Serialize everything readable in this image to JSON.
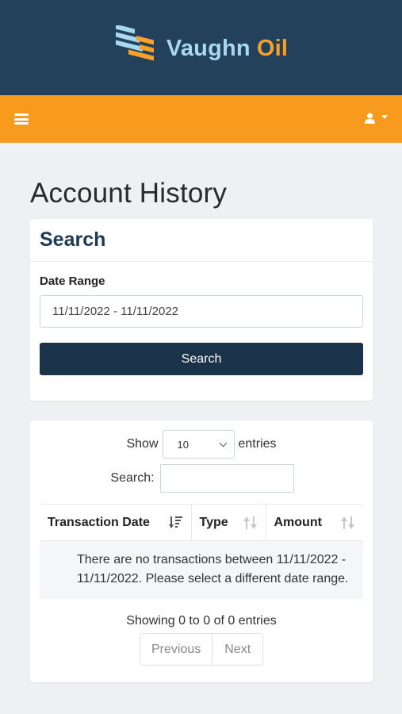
{
  "brand": {
    "name_part1": "Vaughn",
    "name_part2": "Oil"
  },
  "colors": {
    "header": "#23415b",
    "navbar": "#f79a1e",
    "button": "#1b3349",
    "brand_light": "#a8d8f0",
    "brand_accent": "#f7a12a"
  },
  "icons": {
    "menu": "hamburger-icon",
    "user": "user-icon",
    "caret": "caret-down-icon",
    "sort": "sort-icon"
  },
  "page": {
    "title": "Account History"
  },
  "search_card": {
    "heading": "Search",
    "date_range_label": "Date Range",
    "date_range_value": "11/11/2022 - 11/11/2022",
    "search_button": "Search"
  },
  "table_card": {
    "show_label": "Show",
    "entries_per_page": "10",
    "entries_label": "entries",
    "search_label": "Search:",
    "search_value": "",
    "columns": [
      "Transaction Date",
      "Type",
      "Amount"
    ],
    "empty_message": "There are no transactions between 11/11/2022 - 11/11/2022. Please select a different date range.",
    "info": "Showing 0 to 0 of 0 entries",
    "previous": "Previous",
    "next": "Next"
  }
}
